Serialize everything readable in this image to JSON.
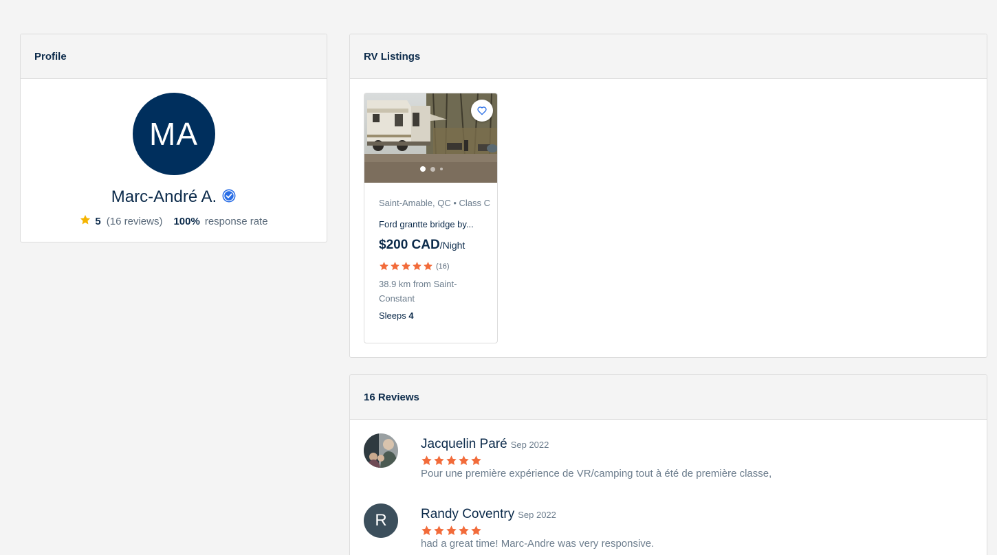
{
  "profile": {
    "header": "Profile",
    "initials": "MA",
    "name": "Marc-André A.",
    "rating": "5",
    "reviews_text": "(16 reviews)",
    "response_rate": "100%",
    "response_label": "response rate"
  },
  "listings": {
    "header": "RV Listings",
    "items": [
      {
        "location": "Saint-Amable, QC • Class C",
        "title": "Ford grantte bridge by...",
        "price": "$200 CAD",
        "unit": "/Night",
        "rating_stars": 5,
        "rating_count": "(16)",
        "distance": "38.9 km from Saint-Constant",
        "sleeps_label": "Sleeps",
        "sleeps_value": "4",
        "photo_count": 3,
        "active_photo": 1
      }
    ]
  },
  "reviews": {
    "header": "16 Reviews",
    "items": [
      {
        "name": "Jacquelin Paré",
        "date": "Sep 2022",
        "stars": 5,
        "text": "Pour une première expérience de VR/camping tout à été de première classe,",
        "avatar": "photo"
      },
      {
        "name": "Randy Coventry",
        "date": "Sep 2022",
        "stars": 5,
        "text": "had a great time! Marc-Andre was very responsive.",
        "avatar_letter": "R"
      }
    ]
  },
  "colors": {
    "navy": "#002f5d",
    "star_orange": "#f26b3a",
    "star_gold": "#f5b400",
    "verified_blue": "#2a6ee6"
  }
}
